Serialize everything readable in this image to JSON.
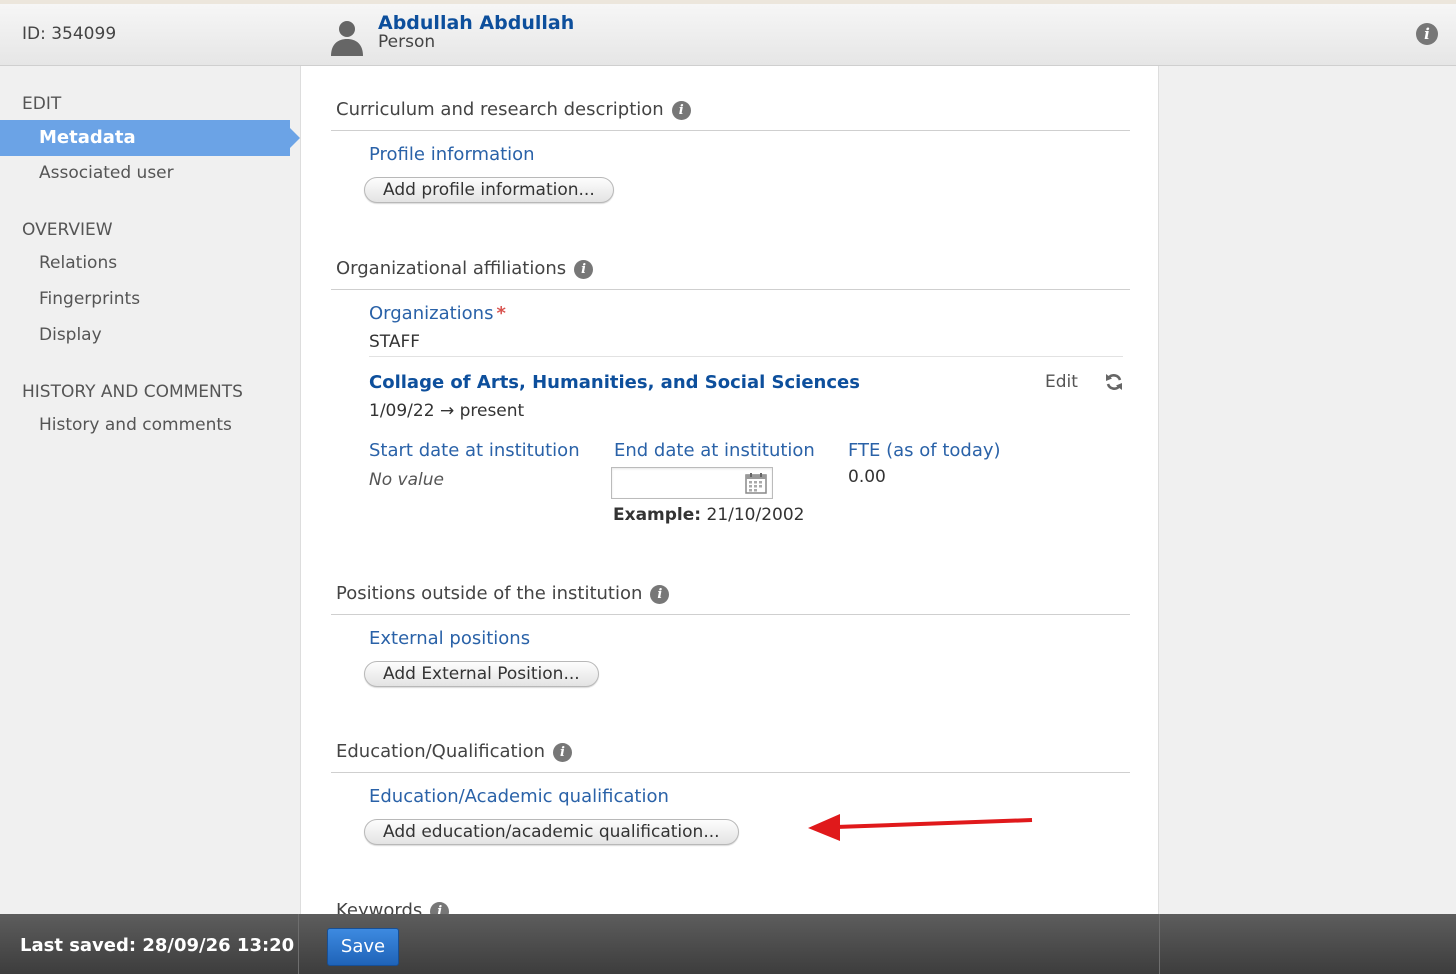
{
  "header": {
    "id_text": "ID: 354099",
    "person_name": "Abdullah Abdullah",
    "person_type": "Person"
  },
  "sidebar": {
    "sections": [
      {
        "heading": "EDIT",
        "items": [
          "Metadata",
          "Associated user"
        ]
      },
      {
        "heading": "OVERVIEW",
        "items": [
          "Relations",
          "Fingerprints",
          "Display"
        ]
      },
      {
        "heading": "HISTORY AND COMMENTS",
        "items": [
          "History and comments"
        ]
      }
    ],
    "active_item": "Metadata"
  },
  "main": {
    "curriculum": {
      "title": "Curriculum and research description",
      "field_label": "Profile information",
      "button": "Add profile information..."
    },
    "affiliations": {
      "title": "Organizational affiliations",
      "field_label": "Organizations",
      "type_label": "STAFF",
      "org_name": "Collage of Arts,  Humanities, and Social Sciences",
      "edit_label": "Edit",
      "date_range": "1/09/22 → present",
      "start_label": "Start date at institution",
      "start_value": "No value",
      "end_label": "End date at institution",
      "end_value": "",
      "example_label": "Example:",
      "example_value": "21/10/2002",
      "fte_label": "FTE (as of today)",
      "fte_value": "0.00"
    },
    "positions": {
      "title": "Positions outside of the institution",
      "field_label": "External positions",
      "button": "Add External Position..."
    },
    "education": {
      "title": "Education/Qualification",
      "field_label": "Education/Academic qualification",
      "button": "Add education/academic qualification..."
    },
    "keywords": {
      "title": "Keywords"
    }
  },
  "footer": {
    "last_saved": "Last saved: 28/09/26 13:20",
    "save_label": "Save"
  },
  "colors": {
    "accent": "#6ba3e6",
    "link": "#2a62a8",
    "heading_link": "#0d4f9c",
    "required": "#d9534f",
    "arrow": "#e0191b",
    "save_button": "#2a72cc"
  },
  "icons": [
    "person-icon",
    "info-icon",
    "refresh-icon",
    "calendar-icon",
    "arrow-annotation"
  ]
}
